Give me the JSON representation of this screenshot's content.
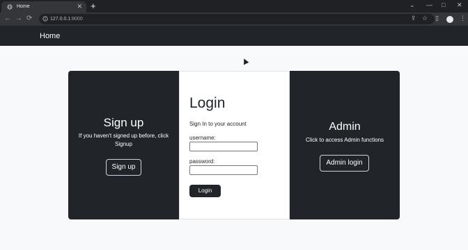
{
  "browser": {
    "tab_title": "Home",
    "tab_close": "✕",
    "new_tab": "+",
    "url_host": "127.0.0.1",
    "url_port": ":8000",
    "controls": {
      "minimize": "—",
      "maximize": "□",
      "close": "✕",
      "dropdown": "⌄"
    },
    "nav": {
      "back": "←",
      "forward": "→",
      "reload": "⟳"
    },
    "toolbar_icons": {
      "share": "⇪",
      "bookmark": "☆",
      "side_panel": "▯",
      "menu": "⋮"
    }
  },
  "navbar": {
    "brand": "Home"
  },
  "signup": {
    "title": "Sign up",
    "description": "If you haven't signed up before, click Signup",
    "button": "Sign up"
  },
  "login": {
    "title": "Login",
    "subtitle": "Sign In to your account",
    "username_label": "username:",
    "username_value": "",
    "password_label": "password:",
    "password_value": "",
    "button": "Login"
  },
  "admin": {
    "title": "Admin",
    "description": "Click to access Admin functions",
    "button": "Admin login"
  }
}
